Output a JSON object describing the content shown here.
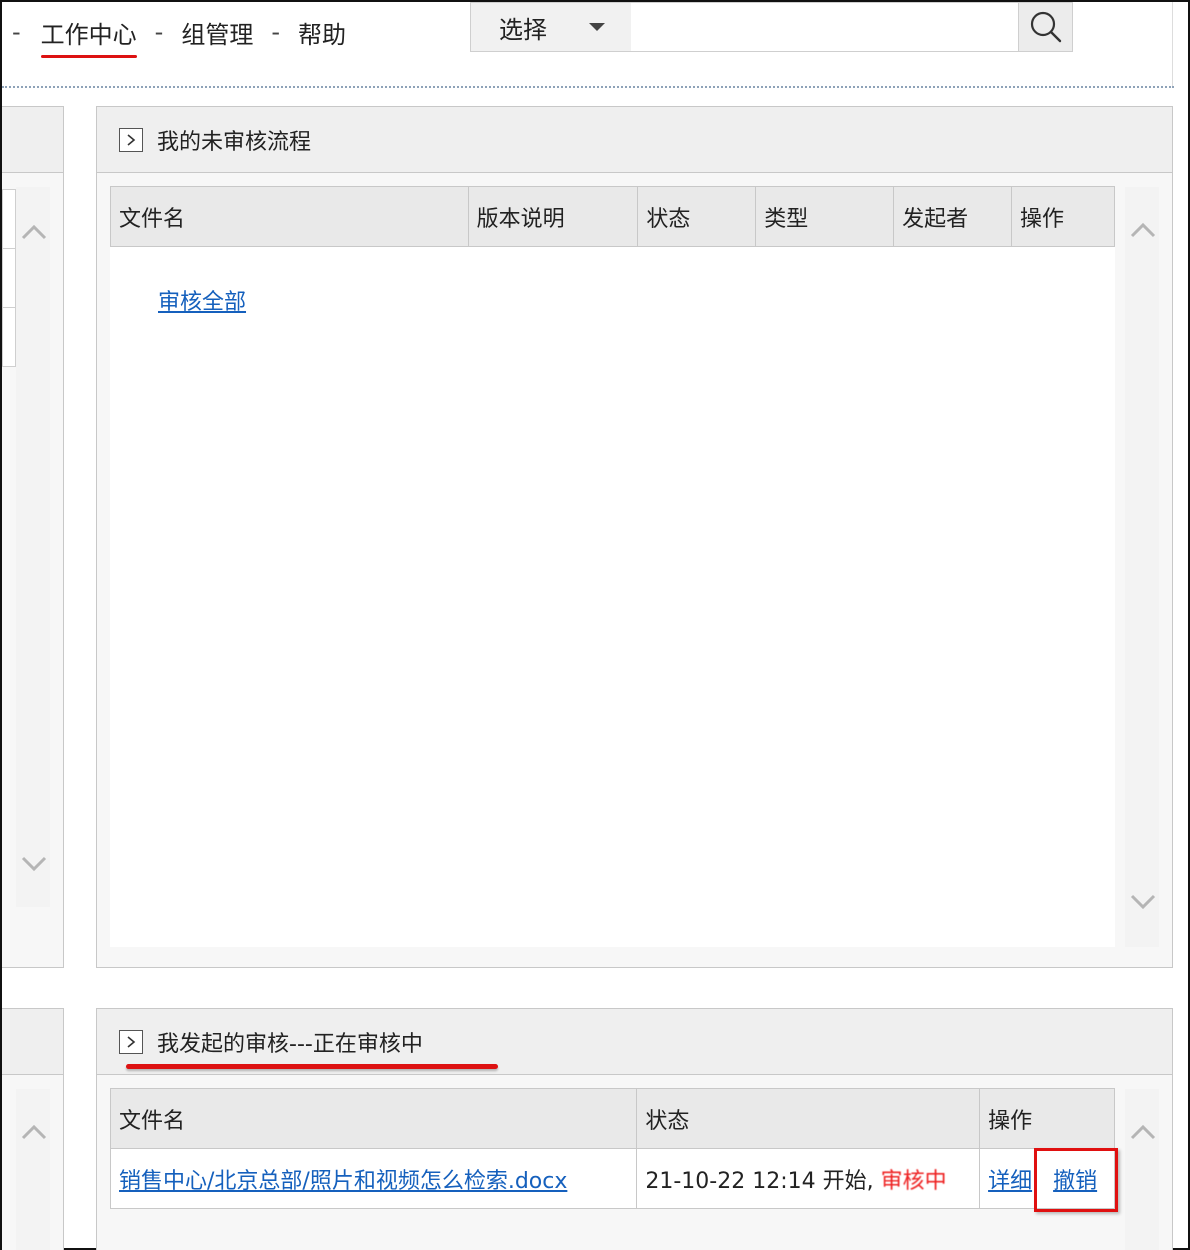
{
  "nav": {
    "leading_sep": "-",
    "items": [
      {
        "label": "工作中心",
        "active": true
      },
      {
        "label": "组管理",
        "active": false
      },
      {
        "label": "帮助",
        "active": false
      }
    ],
    "separator": "-"
  },
  "search": {
    "scope_selected": "选择",
    "query": "",
    "search_icon": "search-icon"
  },
  "pending_panel": {
    "title": "我的未审核流程",
    "columns": [
      "文件名",
      "版本说明",
      "状态",
      "类型",
      "发起者",
      "操作"
    ],
    "approve_all_label": "审核全部"
  },
  "initiated_panel": {
    "title": "我发起的审核---正在审核中",
    "columns": [
      "文件名",
      "状态",
      "操作"
    ],
    "rows": [
      {
        "file": "销售中心/北京总部/照片和视频怎么检索.docx",
        "status_prefix": "21-10-22 12:14 开始,",
        "status_state": "审核中",
        "action_detail": "详细",
        "action_revoke": "撤销"
      }
    ]
  },
  "colors": {
    "accent_red": "#dd1111",
    "link_blue": "#1560bd",
    "header_bg": "#efefef"
  }
}
